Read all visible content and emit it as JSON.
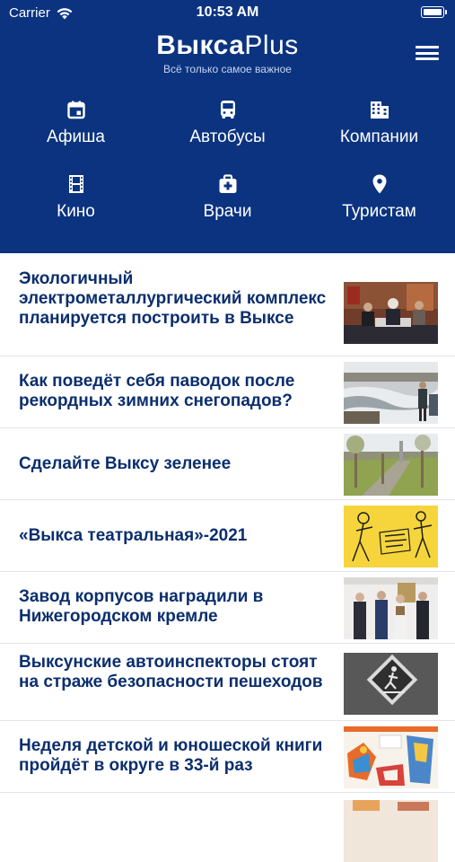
{
  "status_bar": {
    "carrier": "Carrier",
    "time": "10:53 AM",
    "battery_level": 1.0
  },
  "header": {
    "logo_bold": "Выкса",
    "logo_light": "Plus",
    "tagline": "Всё только самое важное",
    "background_color": "#0b3380"
  },
  "quick_links": [
    {
      "label": "Афиша",
      "icon": "calendar-icon"
    },
    {
      "label": "Автобусы",
      "icon": "bus-icon"
    },
    {
      "label": "Компании",
      "icon": "building-icon"
    },
    {
      "label": "Кино",
      "icon": "film-icon"
    },
    {
      "label": "Врачи",
      "icon": "medical-kit-icon"
    },
    {
      "label": "Туристам",
      "icon": "location-pin-icon"
    }
  ],
  "news": [
    {
      "title": "Экологичный электрометаллургический комплекс планируется построить в Выксе",
      "thumbnail": "press-conference-photo"
    },
    {
      "title": "Как поведёт себя паводок после рекордных зимних снегопадов?",
      "thumbnail": "flood-river-photo"
    },
    {
      "title": "Сделайте Выксу зеленее",
      "thumbnail": "young-trees-photo"
    },
    {
      "title": "«Выкса театральная»-2021",
      "thumbnail": "theatre-festival-poster"
    },
    {
      "title": "Завод корпусов наградили в Нижегородском кремле",
      "thumbnail": "award-ceremony-photo"
    },
    {
      "title": "Выксунские автоинспекторы стоят на страже безопасности пешеходов",
      "thumbnail": "pedestrian-sign-photo"
    },
    {
      "title": "Неделя детской и юношеской книги пройдёт в округе в 33-й раз",
      "thumbnail": "book-week-poster"
    },
    {
      "title": "",
      "thumbnail": "partial-photo"
    }
  ]
}
